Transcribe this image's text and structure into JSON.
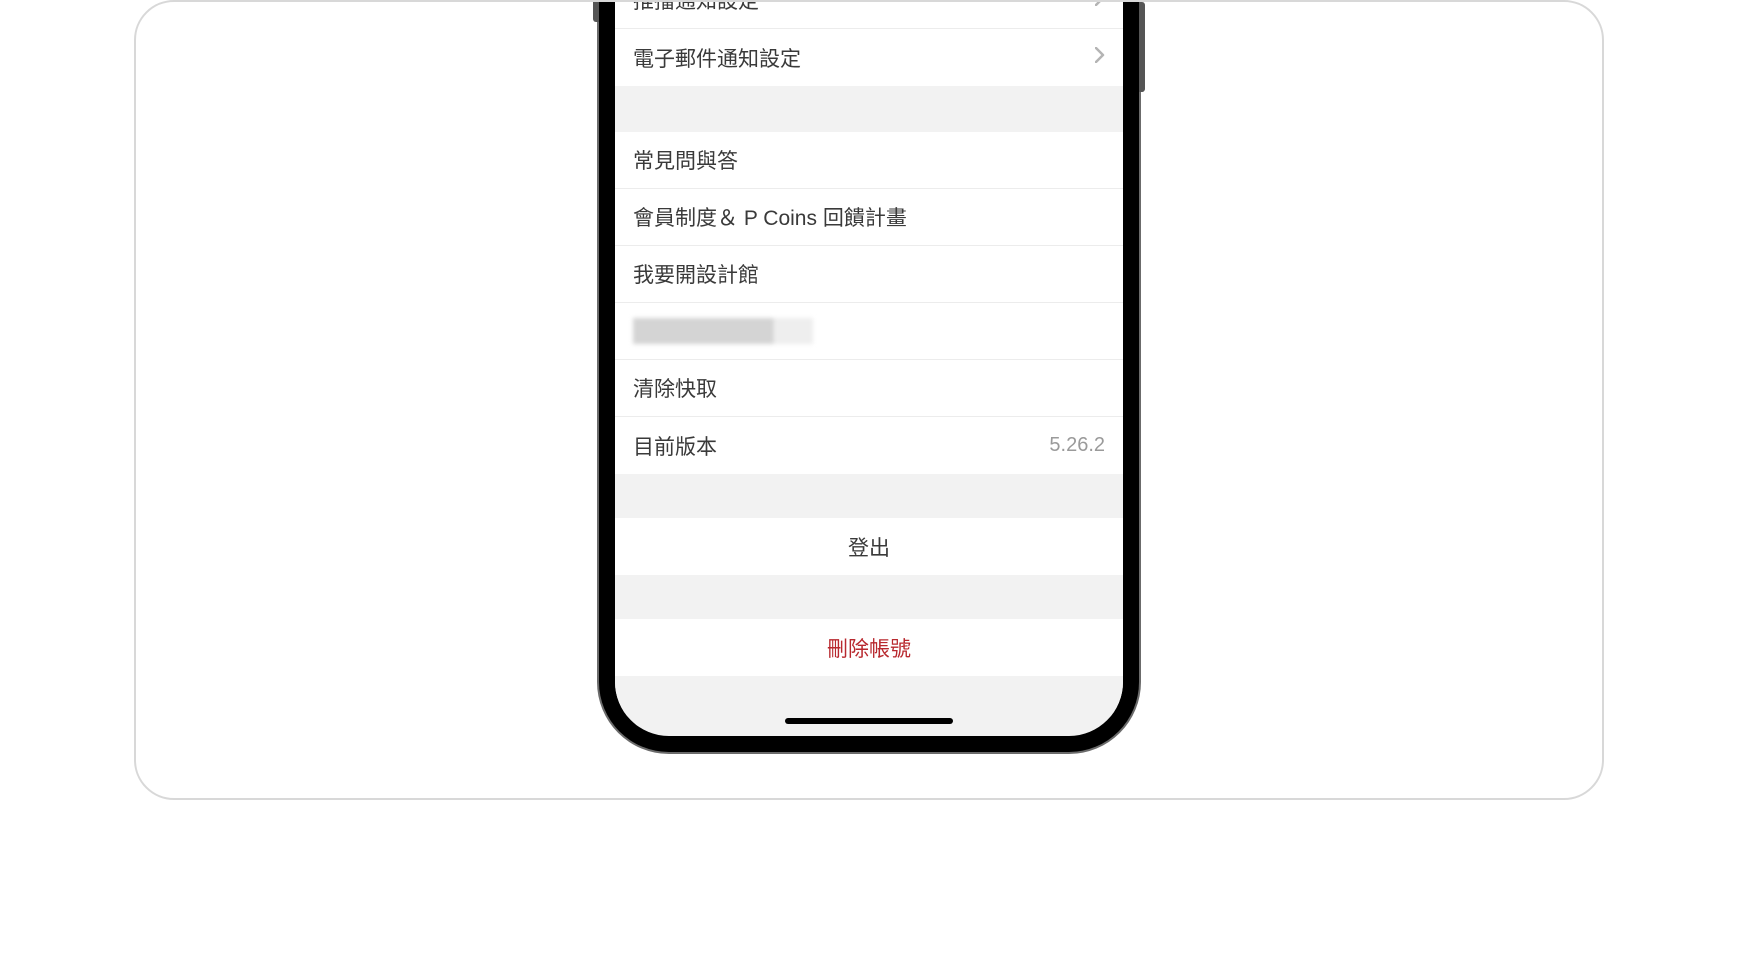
{
  "section1": {
    "push_notification": "推播通知設定",
    "email_notification": "電子郵件通知設定"
  },
  "section2": {
    "faq": "常見問與答",
    "membership": "會員制度＆ P Coins 回饋計畫",
    "open_shop": "我要開設計館",
    "clear_cache": "清除快取",
    "version_label": "目前版本",
    "version_value": "5.26.2"
  },
  "actions": {
    "logout": "登出",
    "delete_account": "刪除帳號"
  }
}
